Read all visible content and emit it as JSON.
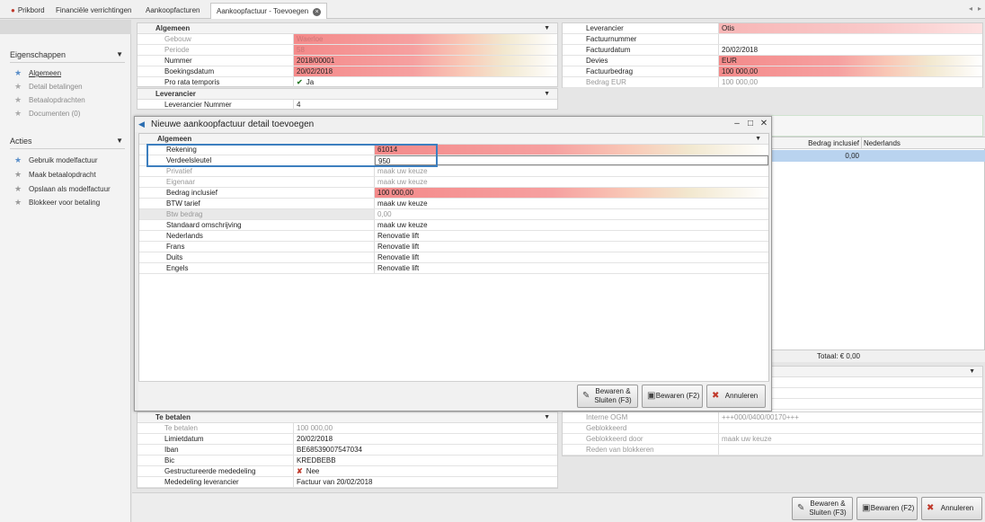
{
  "tabs": [
    {
      "label": "Prikbord",
      "icon": "person-icon"
    },
    {
      "label": "Financiële verrichtingen"
    },
    {
      "label": "Aankoopfacturen"
    },
    {
      "label": "Aankoopfactuur - Toevoegen",
      "active": true
    }
  ],
  "sidebar": {
    "eigenschappen": {
      "title": "Eigenschappen",
      "items": [
        {
          "label": "Algemeen",
          "enabled": true
        },
        {
          "label": "Detail betalingen",
          "enabled": false
        },
        {
          "label": "Betaalopdrachten",
          "enabled": false
        },
        {
          "label": "Documenten (0)",
          "enabled": false
        }
      ]
    },
    "acties": {
      "title": "Acties",
      "items": [
        {
          "label": "Gebruik modelfactuur"
        },
        {
          "label": "Maak betaalopdracht"
        },
        {
          "label": "Opslaan als modelfactuur"
        },
        {
          "label": "Blokkeer voor betaling"
        }
      ]
    }
  },
  "algemeen": {
    "title": "Algemeen",
    "rows": [
      {
        "label": "Gebouw",
        "value": "Waerloe"
      },
      {
        "label": "Periode",
        "value": "58"
      },
      {
        "label": "Nummer",
        "value": "2018/00001"
      },
      {
        "label": "Boekingsdatum",
        "value": "20/02/2018"
      },
      {
        "label": "Pro rata temporis",
        "value": "Ja"
      }
    ]
  },
  "leverancier": {
    "title": "Leverancier",
    "rows": [
      {
        "label": "Leverancier Nummer",
        "value": "4"
      }
    ]
  },
  "invoice_right": {
    "rows": [
      {
        "label": "Leverancier",
        "value": "Otis"
      },
      {
        "label": "Factuurnummer",
        "value": ""
      },
      {
        "label": "Factuurdatum",
        "value": "20/02/2018"
      },
      {
        "label": "Devies",
        "value": "EUR"
      },
      {
        "label": "Factuurbedrag",
        "value": "100 000,00"
      },
      {
        "label": "Bedrag EUR",
        "value": "100 000,00"
      }
    ]
  },
  "grid": {
    "columns": [
      "Bedrag inclusief",
      "Nederlands"
    ],
    "row_value": "0,00",
    "total": "Totaal: € 0,00"
  },
  "te_betalen": {
    "title": "Te betalen",
    "rows": [
      {
        "label": "Te betalen",
        "value": "100 000,00"
      },
      {
        "label": "Limietdatum",
        "value": "20/02/2018"
      },
      {
        "label": "Iban",
        "value": "BE68539007547034"
      },
      {
        "label": "Bic",
        "value": "KREDBEBB"
      },
      {
        "label": "Gestructureerde mededeling",
        "value": "Nee"
      },
      {
        "label": "Mededeling leverancier",
        "value": "Factuur van 20/02/2018"
      }
    ]
  },
  "right_bottom": {
    "rows": [
      {
        "label": "Interne OGM",
        "value": "+++000/0400/00170+++"
      },
      {
        "label": "Geblokkeerd",
        "value": ""
      },
      {
        "label": "Geblokkeerd door",
        "value": "maak uw keuze"
      },
      {
        "label": "Reden van blokkeren",
        "value": ""
      }
    ]
  },
  "dialog": {
    "title": "Nieuwe aankoopfactuur detail toevoegen",
    "group": "Algemeen",
    "rows": [
      {
        "label": "Rekening",
        "value": "61014"
      },
      {
        "label": "Verdeelsleutel",
        "value": "950"
      },
      {
        "label": "Privatief",
        "value": "maak uw keuze"
      },
      {
        "label": "Eigenaar",
        "value": "maak uw keuze"
      },
      {
        "label": "Bedrag inclusief",
        "value": "100 000,00"
      },
      {
        "label": "BTW tarief",
        "value": "maak uw keuze"
      },
      {
        "label": "Btw bedrag",
        "value": "0,00"
      },
      {
        "label": "Standaard omschrijving",
        "value": "maak uw keuze"
      },
      {
        "label": "Nederlands",
        "value": "Renovatie lift"
      },
      {
        "label": "Frans",
        "value": "Renovatie lift"
      },
      {
        "label": "Duits",
        "value": "Renovatie lift"
      },
      {
        "label": "Engels",
        "value": "Renovatie lift"
      }
    ],
    "buttons": {
      "save_close": "Bewaren & Sluiten (F3)",
      "save": "Bewaren (F2)",
      "cancel": "Annuleren"
    }
  },
  "footer": {
    "save_close": "Bewaren & Sluiten (F3)",
    "save": "Bewaren (F2)",
    "cancel": "Annuleren"
  }
}
